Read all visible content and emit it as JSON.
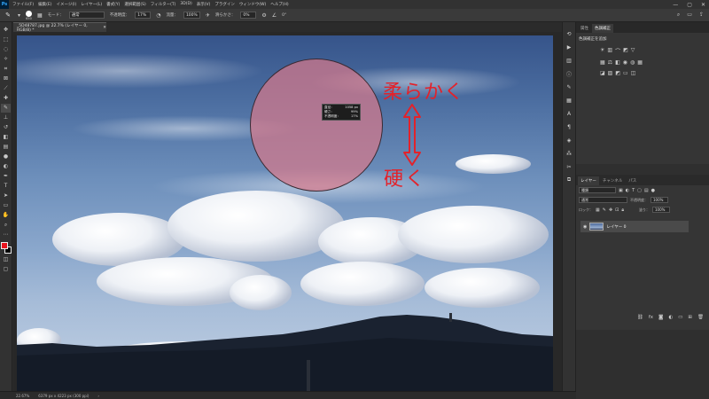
{
  "app": {
    "logo": "Ps",
    "menu": [
      "ファイル(F)",
      "編集(E)",
      "イメージ(I)",
      "レイヤー(L)",
      "書式(Y)",
      "選択範囲(S)",
      "フィルター(T)",
      "3D(D)",
      "表示(V)",
      "プラグイン",
      "ウィンドウ(W)",
      "ヘルプ(H)"
    ],
    "window_controls": [
      "—",
      "▢",
      "✕"
    ]
  },
  "options": {
    "brush_size": "650",
    "mode_label": "モード：",
    "mode_value": "通常",
    "opacity_label": "不透明度：",
    "opacity_value": "17%",
    "flow_label": "流量：",
    "flow_value": "100%",
    "smoothing_label": "滑らかさ：",
    "smoothing_value": "0%",
    "angle_value": "0°"
  },
  "document": {
    "tab_title": "_5D48787.jpg @ 22.7% (レイヤー 0, RGB/8) *",
    "tab_close": "✕"
  },
  "brush_hud": {
    "rows": [
      {
        "label": "直径：",
        "value": "1058 px"
      },
      {
        "label": "硬さ：",
        "value": "99%"
      },
      {
        "label": "不透明度：",
        "value": "17%"
      }
    ]
  },
  "annotations": {
    "soft": "柔らかく",
    "hard": "硬く",
    "arrow_color": "#e3222a"
  },
  "status": {
    "zoom": "22.67%",
    "dimensions": "6379 px x 4223 px (300 ppi)",
    "nav": "›"
  },
  "right_panel": {
    "top_tabs": [
      "属性",
      "色調補正"
    ],
    "adjustments_title": "色調補正を追加",
    "layer_tabs": [
      "レイヤー",
      "チャンネル",
      "パス"
    ],
    "kind_label": "種類",
    "blend_mode": "通常",
    "opacity_label": "不透明度：",
    "opacity_value": "100%",
    "lock_label": "ロック：",
    "fill_label": "塗り：",
    "fill_value": "100%",
    "layer_name": "レイヤー 0"
  },
  "colors": {
    "foreground": "#e8141e",
    "background": "#000000",
    "brush_overlay": "#d6788a"
  }
}
